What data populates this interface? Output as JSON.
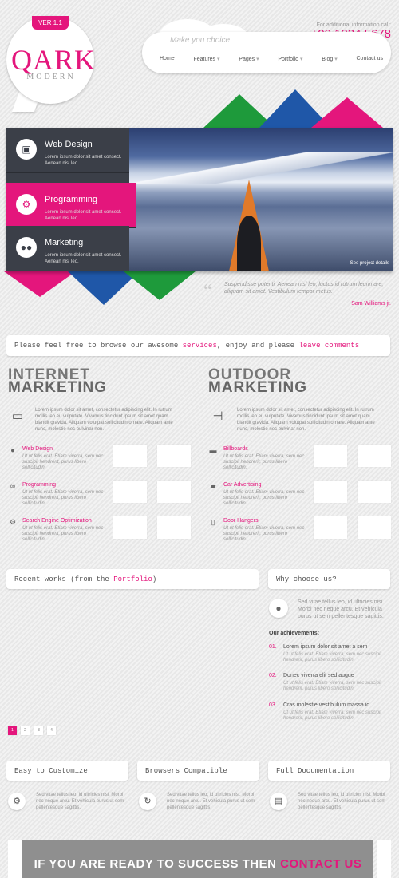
{
  "logo": {
    "version": "VER 1.1",
    "name": "QARK",
    "sub": "MODERN"
  },
  "header": {
    "info": "For additional information call:",
    "phone": "+00 1234 5678",
    "slogan": "Make you choice",
    "nav": [
      "Home",
      "Features",
      "Pages",
      "Portfolio",
      "Blog",
      "Contact us"
    ]
  },
  "slider": {
    "tabs": [
      {
        "title": "Web Design",
        "desc": "Lorem ipsum dolor sit amet consect. Aenean nisl leo.",
        "icon": "image-icon"
      },
      {
        "title": "Programming",
        "desc": "Lorem ipsum dolor sit amet consect. Aenean nisl leo.",
        "icon": "gear-icon"
      },
      {
        "title": "Marketing",
        "desc": "Lorem ipsum dolor sit amet consect. Aenean nisl leo.",
        "icon": "users-icon"
      }
    ],
    "see_project": "See project details"
  },
  "testimonial": {
    "text": "Suspendisse potenti. Aenean nisl leo, luctus id rutrum leonmare, aliquam sit amet. Vestibulum tempor metus.",
    "author": "Sam Williams jr."
  },
  "intro": {
    "pre": "Please feel free to browse our awesome ",
    "link1": "services",
    "mid": ", enjoy and please ",
    "link2": "leave comments"
  },
  "internet": {
    "title1": "INTERNET",
    "title2": "MARKETING",
    "text": "Lorem ipsum dolor sit amet, consectetur adipiscing elit. In rutrum mollis leo eu vulputate. Vivamus tincidunt ipsum sit amet quam blandit gravida. Aliquam volutpat sollicitudin ornare. Aliquam ante nunc, molestie nec pulvinar non.",
    "items": [
      {
        "title": "Web Design",
        "desc": "Ut ut felis erat. Etiam viverra, sem nec suscipit hendrerit, purus libero sollicitudin."
      },
      {
        "title": "Programming",
        "desc": "Ut ut felis erat. Etiam viverra, sem nec suscipit hendrerit, purus libero sollicitudin."
      },
      {
        "title": "Search Engine Optimization",
        "desc": "Ut ut felis erat. Etiam viverra, sem nec suscipit hendrerit, purus libero sollicitudin."
      }
    ]
  },
  "outdoor": {
    "title1": "OUTDOOR",
    "title2": "MARKETING",
    "text": "Lorem ipsum dolor sit amet, consectetur adipiscing elit. In rutrum mollis leo eu vulputate. Vivamus tincidunt ipsum sit amet quam blandit gravida. Aliquam volutpat sollicitudin ornare. Aliquam ante nunc, molestie nec pulvinar non.",
    "items": [
      {
        "title": "Billboards",
        "desc": "Ut ut felis erat. Etiam viverra, sem nec suscipit hendrerit, purus libero sollicitudin."
      },
      {
        "title": "Car Advertising",
        "desc": "Ut ut felis erat. Etiam viverra, sem nec suscipit hendrerit, purus libero sollicitudin."
      },
      {
        "title": "Door Hangers",
        "desc": "Ut ut felis erat. Etiam viverra, sem nec suscipit hendrerit, purus libero sollicitudin."
      }
    ]
  },
  "recent": {
    "pre": "Recent works (from the ",
    "link": "Portfolio",
    "post": ")",
    "pages": [
      "1",
      "2",
      "3",
      "4"
    ]
  },
  "why": {
    "title": "Why choose us?",
    "text": "Sed vitae tellus leo, id ultricies nisi. Morbi nec neque arcu. Et vehicula purus ut sem pellentesque sagittis.",
    "achievements_title": "Our achievements:",
    "items": [
      {
        "num": "01.",
        "title": "Lorem ipsum dolor sit amet a sem",
        "desc": "Ut ut felis erat. Etiam viverra, sem nec suscipit hendrerit, purus libero sollicitudin."
      },
      {
        "num": "02.",
        "title": "Donec viverra elit sed augue",
        "desc": "Ut ut felis erat. Etiam viverra, sem nec suscipit hendrerit, purus libero sollicitudin."
      },
      {
        "num": "03.",
        "title": "Cras molestie vestibulum massa id",
        "desc": "Ut ut felis erat. Etiam viverra, sem nec suscipit hendrerit, purus libero sollicitudin."
      }
    ]
  },
  "features": [
    {
      "title": "Easy to Customize",
      "desc": "Sed vitae tellus leo, id ultricies nisi. Morbi nec neque arcu. Et vehicula purus ut sem pellentesque sagittis."
    },
    {
      "title": "Browsers Compatible",
      "desc": "Sed vitae tellus leo, id ultricies nisi. Morbi nec neque arcu. Et vehicula purus ut sem pellentesque sagittis."
    },
    {
      "title": "Full Documentation",
      "desc": "Sed vitae tellus leo, id ultricies nisi. Morbi nec neque arcu. Et vehicula purus ut sem pellentesque sagittis."
    }
  ],
  "cta": {
    "pre": "IF YOU ARE READY TO SUCCESS THEN ",
    "link": "CONTACT US"
  },
  "colors": {
    "accent": "#e4167c",
    "dark": "#3b3f48",
    "green": "#1e9a3b",
    "blue": "#1f57a8"
  }
}
